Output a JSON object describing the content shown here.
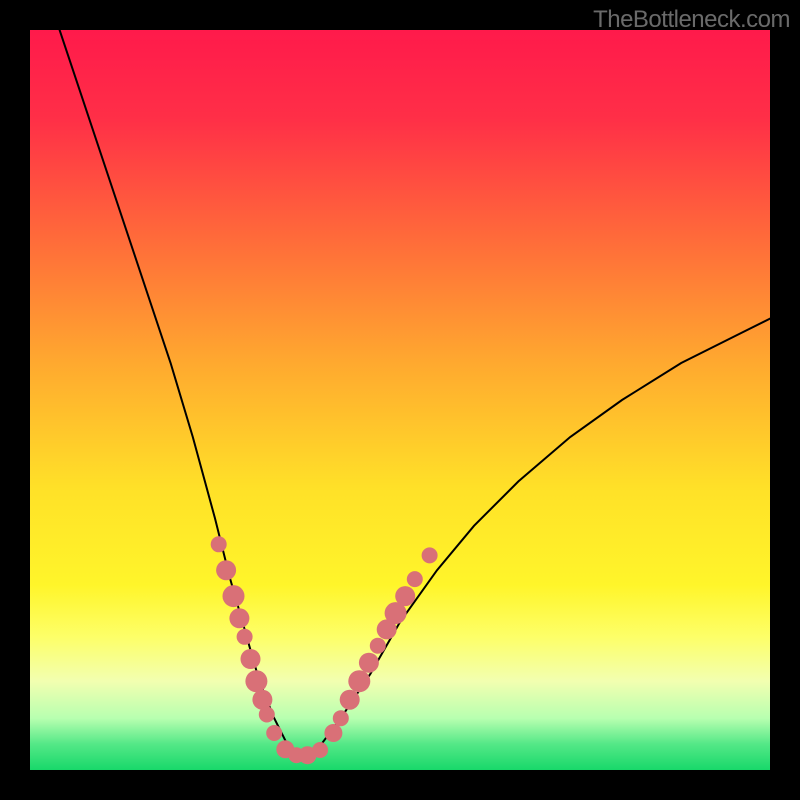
{
  "watermark": "TheBottleneck.com",
  "colors": {
    "background": "#000000",
    "curve": "#000000",
    "dots": "#d97077",
    "watermark_text": "#6a6a6a"
  },
  "plot": {
    "gradient_stops": [
      {
        "offset": 0.0,
        "color": "#ff1a4b"
      },
      {
        "offset": 0.12,
        "color": "#ff2f47"
      },
      {
        "offset": 0.28,
        "color": "#ff6a3a"
      },
      {
        "offset": 0.45,
        "color": "#ffa92f"
      },
      {
        "offset": 0.62,
        "color": "#ffe128"
      },
      {
        "offset": 0.75,
        "color": "#fff52a"
      },
      {
        "offset": 0.82,
        "color": "#fdff68"
      },
      {
        "offset": 0.88,
        "color": "#f2ffb0"
      },
      {
        "offset": 0.93,
        "color": "#b8ffb0"
      },
      {
        "offset": 0.965,
        "color": "#54e887"
      },
      {
        "offset": 1.0,
        "color": "#18d86a"
      }
    ]
  },
  "chart_data": {
    "type": "line",
    "title": "",
    "xlabel": "",
    "ylabel": "",
    "xlim": [
      0,
      1
    ],
    "ylim": [
      0,
      1
    ],
    "notes": "Bottleneck-style V-curve. Higher y = worse match (red), lower y near minimum = best match (green band). Dots mark sampled hardware points near the minimum.",
    "series": [
      {
        "name": "bottleneck-curve",
        "x": [
          0.04,
          0.07,
          0.1,
          0.13,
          0.16,
          0.19,
          0.22,
          0.25,
          0.27,
          0.29,
          0.31,
          0.33,
          0.35,
          0.37,
          0.39,
          0.42,
          0.46,
          0.5,
          0.55,
          0.6,
          0.66,
          0.73,
          0.8,
          0.88,
          0.96,
          1.0
        ],
        "y": [
          1.0,
          0.91,
          0.82,
          0.73,
          0.64,
          0.55,
          0.45,
          0.34,
          0.26,
          0.19,
          0.12,
          0.07,
          0.03,
          0.02,
          0.03,
          0.07,
          0.13,
          0.2,
          0.27,
          0.33,
          0.39,
          0.45,
          0.5,
          0.55,
          0.59,
          0.61
        ]
      }
    ],
    "dots": [
      {
        "x": 0.255,
        "y": 0.305,
        "r": 8
      },
      {
        "x": 0.265,
        "y": 0.27,
        "r": 10
      },
      {
        "x": 0.275,
        "y": 0.235,
        "r": 11
      },
      {
        "x": 0.283,
        "y": 0.205,
        "r": 10
      },
      {
        "x": 0.29,
        "y": 0.18,
        "r": 8
      },
      {
        "x": 0.298,
        "y": 0.15,
        "r": 10
      },
      {
        "x": 0.306,
        "y": 0.12,
        "r": 11
      },
      {
        "x": 0.314,
        "y": 0.095,
        "r": 10
      },
      {
        "x": 0.32,
        "y": 0.075,
        "r": 8
      },
      {
        "x": 0.33,
        "y": 0.05,
        "r": 8
      },
      {
        "x": 0.345,
        "y": 0.028,
        "r": 9
      },
      {
        "x": 0.36,
        "y": 0.02,
        "r": 8
      },
      {
        "x": 0.375,
        "y": 0.02,
        "r": 9
      },
      {
        "x": 0.392,
        "y": 0.027,
        "r": 8
      },
      {
        "x": 0.41,
        "y": 0.05,
        "r": 9
      },
      {
        "x": 0.42,
        "y": 0.07,
        "r": 8
      },
      {
        "x": 0.432,
        "y": 0.095,
        "r": 10
      },
      {
        "x": 0.445,
        "y": 0.12,
        "r": 11
      },
      {
        "x": 0.458,
        "y": 0.145,
        "r": 10
      },
      {
        "x": 0.47,
        "y": 0.168,
        "r": 8
      },
      {
        "x": 0.482,
        "y": 0.19,
        "r": 10
      },
      {
        "x": 0.494,
        "y": 0.212,
        "r": 11
      },
      {
        "x": 0.507,
        "y": 0.235,
        "r": 10
      },
      {
        "x": 0.52,
        "y": 0.258,
        "r": 8
      },
      {
        "x": 0.54,
        "y": 0.29,
        "r": 8
      }
    ]
  }
}
